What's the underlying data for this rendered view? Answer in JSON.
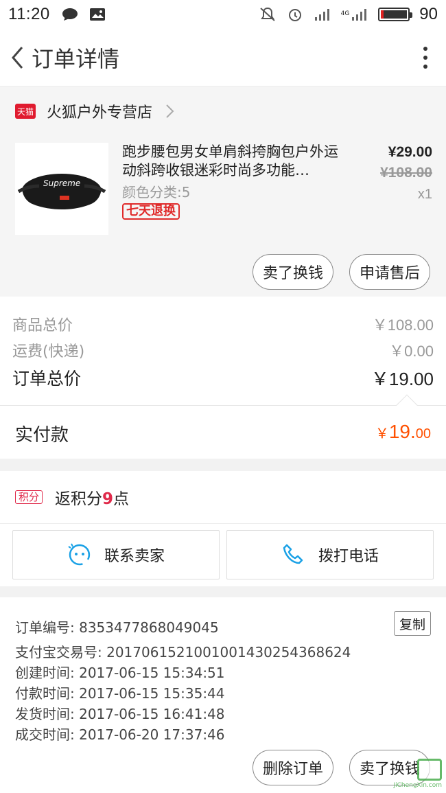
{
  "status_bar": {
    "time": "11:20",
    "network": "4G",
    "battery_percent": "90"
  },
  "nav": {
    "title": "订单详情"
  },
  "shop": {
    "badge": "天猫",
    "name": "火狐户外专营店"
  },
  "item": {
    "title": "跑步腰包男女单肩斜挎胸包户外运动斜跨收银迷彩时尚多功能…",
    "sku": "颜色分类:5",
    "badge": "七天退换",
    "price": "¥29.00",
    "original_price": "¥108.00",
    "quantity": "x1",
    "thumb_logo": "Supreme",
    "buttons": [
      "卖了换钱",
      "申请售后"
    ]
  },
  "price_summary": {
    "goods_label": "商品总价",
    "goods_value": "￥108.00",
    "shipping_label": "运费(快递)",
    "shipping_value": "￥0.00",
    "total_label": "订单总价",
    "total_value": "￥19.00"
  },
  "paid": {
    "label": "实付款",
    "currency": "￥",
    "integer": "19.",
    "decimal": "00"
  },
  "points": {
    "badge": "积分",
    "prefix": "返积分",
    "number": "9",
    "suffix": "点"
  },
  "contact": {
    "seller_label": "联系卖家",
    "phone_label": "拨打电话"
  },
  "order_info": {
    "order_no": "订单编号: 8353477868049045",
    "copy_label": "复制",
    "alipay_no": "支付宝交易号: 2017061521001001430254368624",
    "created": "创建时间: 2017-06-15 15:34:51",
    "paid": "付款时间: 2017-06-15 15:35:44",
    "shipped": "发货时间: 2017-06-15 16:41:48",
    "completed": "成交时间: 2017-06-20 17:37:46"
  },
  "footer_buttons": [
    "删除订单",
    "卖了换钱"
  ],
  "watermark": "JiChengXin.com",
  "colors": {
    "accent": "#ff5000",
    "tmall_red": "#e01b2f",
    "badge_red": "#e02a2a",
    "icon_blue": "#1aa1e6"
  }
}
